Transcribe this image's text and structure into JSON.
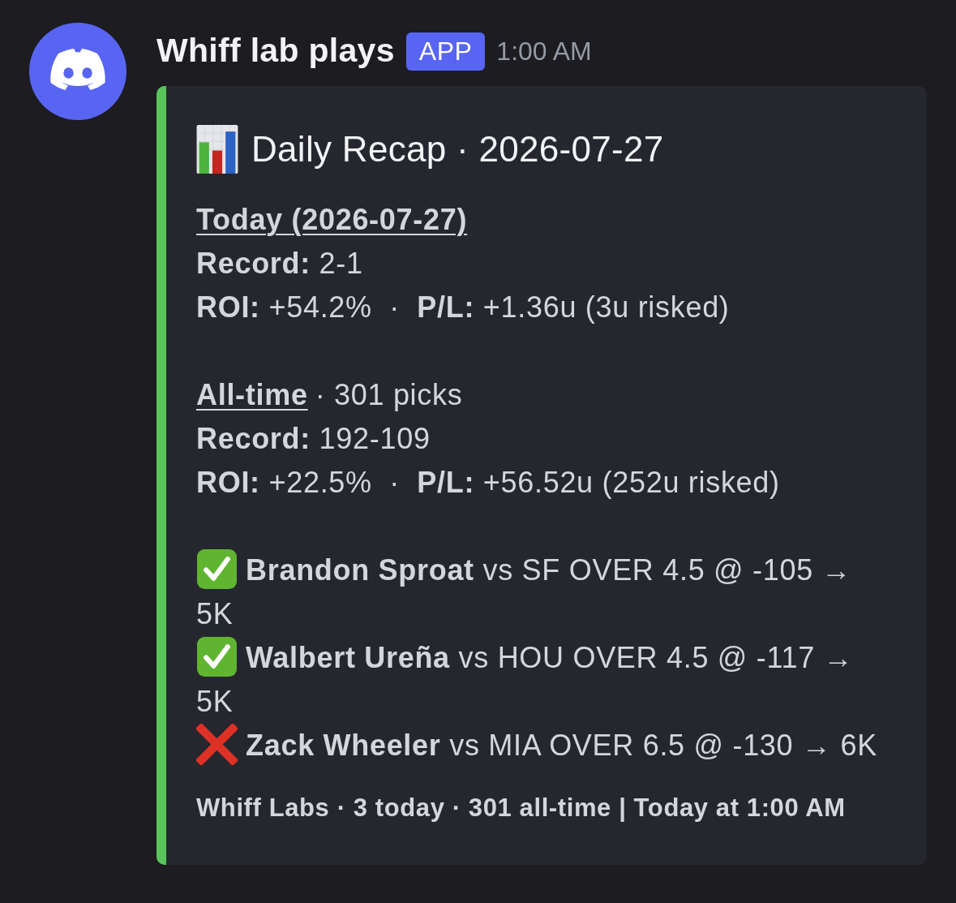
{
  "message": {
    "author": "Whiff lab plays",
    "tag": "APP",
    "time": "1:00 AM"
  },
  "embed": {
    "title": "Daily Recap · 2026-07-27",
    "sections": [
      {
        "heading": "Today (2026-07-27)",
        "lines": [
          "**Record:** 2-1",
          "**ROI:** +54.2%  ·  **P/L:** +1.36u (3u risked)"
        ]
      },
      {
        "heading": "All-time",
        "note": "· 301 picks",
        "lines": [
          "**Record:** 192-109",
          "**ROI:** +22.5%  ·  **P/L:** +56.52u (252u risked)"
        ]
      }
    ],
    "picks": [
      {
        "won": true,
        "text": "**Brandon Sproat** vs SF OVER 4.5 @ -105 → 5K"
      },
      {
        "won": true,
        "text": "**Walbert Ureña** vs HOU OVER 4.5 @ -117 → 5K"
      },
      {
        "won": false,
        "text": "**Zack Wheeler** vs MIA OVER 6.5 @ -130 → 6K"
      }
    ],
    "footer": "Whiff Labs · 3 today · 301 all-time | Today at 1:00 AM"
  }
}
